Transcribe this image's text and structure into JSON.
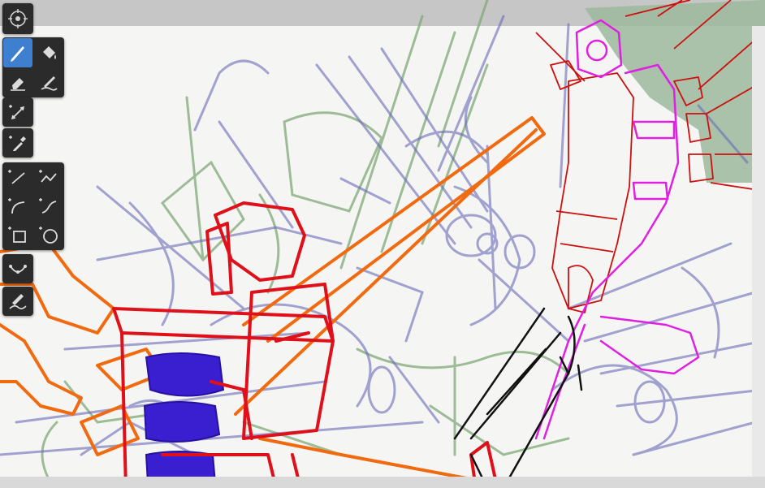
{
  "app": {
    "accent_color": "#3f7fd0",
    "toolbar_bg": "#2b2b2b",
    "paper_color": "#f5f6f3"
  },
  "nav": {
    "icon": "move-canvas-icon"
  },
  "tools": {
    "brush": {
      "icon": "pen-icon",
      "active": true
    },
    "fill": {
      "icon": "paint-bucket-icon"
    },
    "eraser": {
      "icon": "eraser-icon"
    },
    "smudge": {
      "icon": "smudge-icon"
    },
    "transform": {
      "icon": "transform-icon"
    },
    "eyedropper": {
      "icon": "eyedropper-icon"
    },
    "line": {
      "icon": "line-icon"
    },
    "polyline": {
      "icon": "polyline-icon"
    },
    "arc": {
      "icon": "arc-icon"
    },
    "curve": {
      "icon": "curve-icon"
    },
    "rectangle": {
      "icon": "rectangle-icon"
    },
    "ellipse": {
      "icon": "ellipse-icon"
    },
    "perspective": {
      "icon": "perspective-curve-icon"
    },
    "stroke_pen": {
      "icon": "stroke-pen-icon"
    }
  },
  "artwork": {
    "colors": {
      "sketch_blue": "#6a6ab8",
      "sketch_green": "#7fa877",
      "red": "#e0101a",
      "orange": "#f26a10",
      "magenta": "#e020e0",
      "indigo_fill": "#3a1fd0",
      "black": "#111111",
      "green_bg": "#9bb89b"
    }
  }
}
